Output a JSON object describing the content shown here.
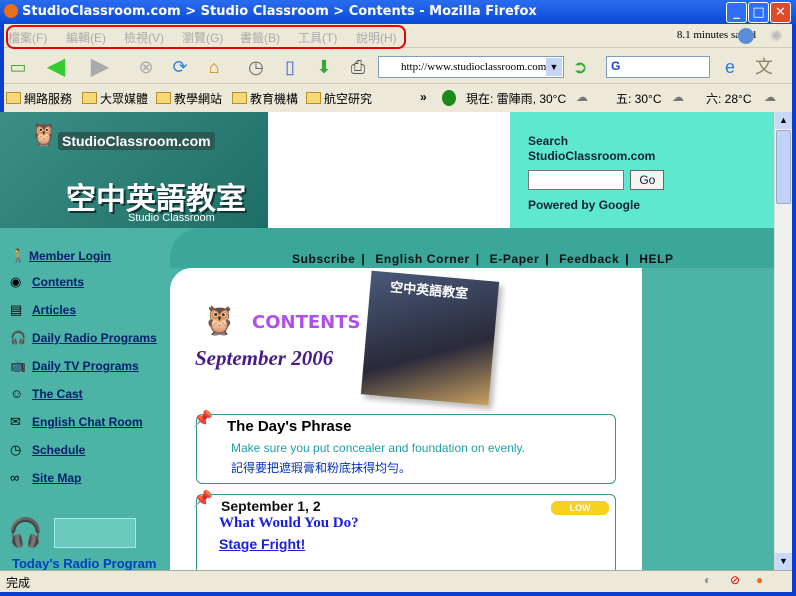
{
  "window": {
    "title": "StudioClassroom.com > Studio Classroom > Contents - Mozilla Firefox"
  },
  "menu": [
    "檔案(F)",
    "編輯(E)",
    "檢視(V)",
    "瀏覽(G)",
    "書籤(B)",
    "工具(T)",
    "說明(H)"
  ],
  "menu_status": "8.1 minutes saved",
  "toolbar": {
    "url": "http://www.studioclassroom.com",
    "search_logo": "G"
  },
  "bookmarks": [
    "網路服務",
    "大眾媒體",
    "教學網站",
    "教育機構",
    "航空研究"
  ],
  "weather": {
    "now": "現在: 雷陣雨, 30°C",
    "fri": "五: 30°C",
    "sat": "六: 28°C"
  },
  "page": {
    "logo": "StudioClassroom.com",
    "logo_cn": "空中英語教室",
    "logo_sub": "Studio Classroom",
    "search": {
      "title": "Search StudioClassroom.com",
      "button": "Go",
      "powered": "Powered by Google"
    },
    "nav": [
      "Subscribe",
      "English Corner",
      "E-Paper",
      "Feedback",
      "HELP"
    ],
    "sidebar": [
      "Member Login",
      "Contents",
      "Articles",
      "Daily Radio Programs",
      "Daily TV Programs",
      "The Cast",
      "English Chat Room",
      "Schedule",
      "Site Map"
    ],
    "radio_title": "Today's Radio Program",
    "contents_heading": "CONTENTS",
    "month": "September 2006",
    "cover_title": "空中英語教室",
    "phrase": {
      "title": "The Day's Phrase",
      "en": "Make sure you put concealer and foundation on evenly.",
      "zh": "記得要把遮瑕膏和粉底抹得均勻。"
    },
    "program": {
      "date": "September 1, 2",
      "level": "LOW",
      "series": "What Would You Do?",
      "title": "Stage Fright!"
    }
  },
  "status": {
    "text": "完成"
  }
}
